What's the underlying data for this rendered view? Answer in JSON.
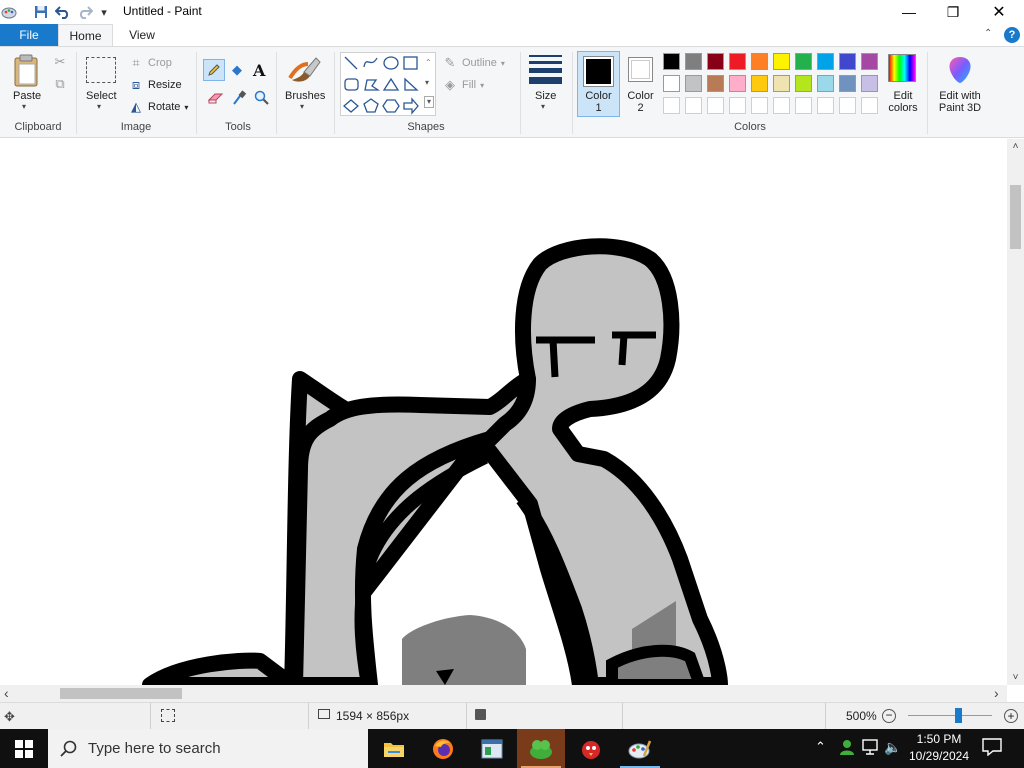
{
  "window": {
    "title": "Untitled - Paint",
    "controls": {
      "minimize": "—",
      "maximize": "❐",
      "close": "✕"
    }
  },
  "quick_access": {
    "dropdown": "▾"
  },
  "tabs": {
    "file": "File",
    "home": "Home",
    "view": "View"
  },
  "help": "?",
  "ribbon": {
    "clipboard": {
      "paste": "Paste",
      "label": "Clipboard"
    },
    "image": {
      "select": "Select",
      "crop": "Crop",
      "resize": "Resize",
      "rotate": "Rotate",
      "label": "Image"
    },
    "tools": {
      "label": "Tools",
      "text_tool": "A"
    },
    "brushes": {
      "label": "Brushes"
    },
    "shapes": {
      "outline": "Outline",
      "fill": "Fill",
      "label": "Shapes"
    },
    "size": {
      "label": "Size"
    },
    "colors": {
      "color1_line1": "Color",
      "color1_line2": "1",
      "color2_line1": "Color",
      "color2_line2": "2",
      "edit_line1": "Edit",
      "edit_line2": "colors",
      "label": "Colors",
      "palette_row1": [
        "#000000",
        "#7f7f7f",
        "#880015",
        "#ed1c24",
        "#ff7f27",
        "#fff200",
        "#22b14c",
        "#00a2e8",
        "#3f48cc",
        "#a349a4"
      ],
      "palette_row2": [
        "#ffffff",
        "#c3c3c3",
        "#b97a57",
        "#ffaec9",
        "#ffc90e",
        "#efe4b0",
        "#b5e61d",
        "#99d9ea",
        "#7092be",
        "#c8bfe7"
      ],
      "color1_value": "#000000",
      "color2_value": "#ffffff"
    },
    "paint3d": {
      "line1": "Edit with",
      "line2": "Paint 3D"
    }
  },
  "status": {
    "dimensions": "1594 × 856px",
    "zoom": "500%",
    "zoom_level_fraction": 0.6
  },
  "taskbar": {
    "search_placeholder": "Type here to search",
    "time": "1:50 PM",
    "date": "10/29/2024"
  },
  "scroll": {
    "left_arrow": "‹",
    "right_arrow": "›",
    "up_arrow": "˄",
    "down_arrow": "˅"
  }
}
